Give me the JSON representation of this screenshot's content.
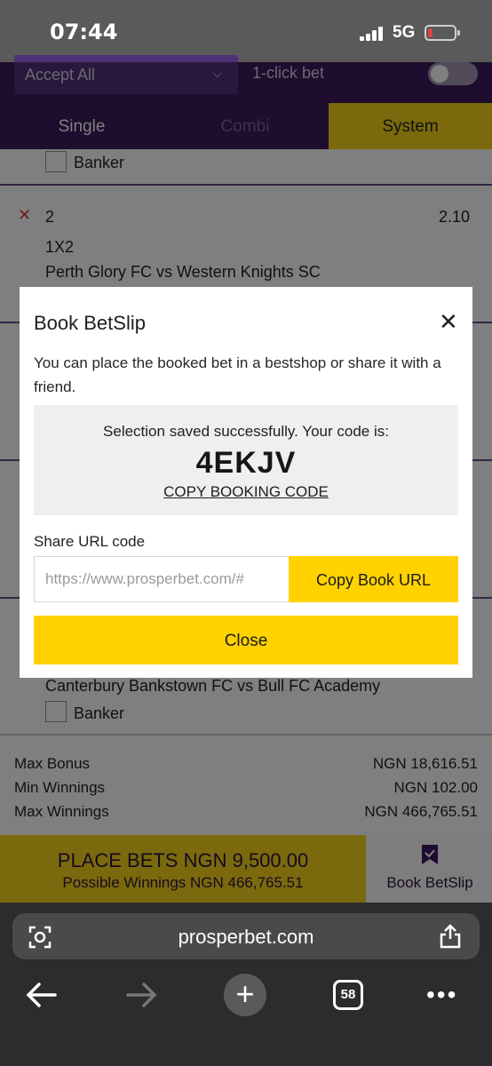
{
  "status_bar": {
    "time": "07:44",
    "network": "5G"
  },
  "header": {
    "accept_select": "Accept All",
    "one_click_label": "1-click bet"
  },
  "bet_tabs": [
    {
      "label": "Single",
      "color": "#ffffff"
    },
    {
      "label": "Combi",
      "color": "#7f6597"
    },
    {
      "label": "System",
      "color": "#222222"
    }
  ],
  "betslip": {
    "banker_label": "Banker",
    "selection_2": {
      "number": "2",
      "odds": "2.10",
      "market": "1X2",
      "match": "Perth Glory FC vs Western Knights SC"
    },
    "last_match": "Canterbury Bankstown FC vs Bull FC Academy"
  },
  "modal": {
    "title": "Book BetSlip",
    "description": "You can place the booked bet in a bestshop or share it with a friend.",
    "success_message": "Selection saved successfully. Your code is:",
    "booking_code": "4EKJV",
    "copy_code_label": "COPY BOOKING CODE",
    "share_label": "Share URL code",
    "share_url_value": "https://www.prosperbet.com/#",
    "copy_url_label": "Copy Book URL",
    "close_label": "Close"
  },
  "summary": [
    {
      "label": "Max Bonus",
      "value": "NGN 18,616.51"
    },
    {
      "label": "Min Winnings",
      "value": "NGN 102.00"
    },
    {
      "label": "Max Winnings",
      "value": "NGN 466,765.51"
    }
  ],
  "place_bets": {
    "label": "PLACE BETS NGN 9,500.00",
    "possible": "Possible Winnings NGN 466,765.51"
  },
  "book_betslip_label": "Book BetSlip",
  "browser": {
    "url": "prosperbet.com",
    "tab_count": "58"
  },
  "colors": {
    "brand_purple": "#3d1a5c",
    "accent_yellow": "#ffd200"
  }
}
